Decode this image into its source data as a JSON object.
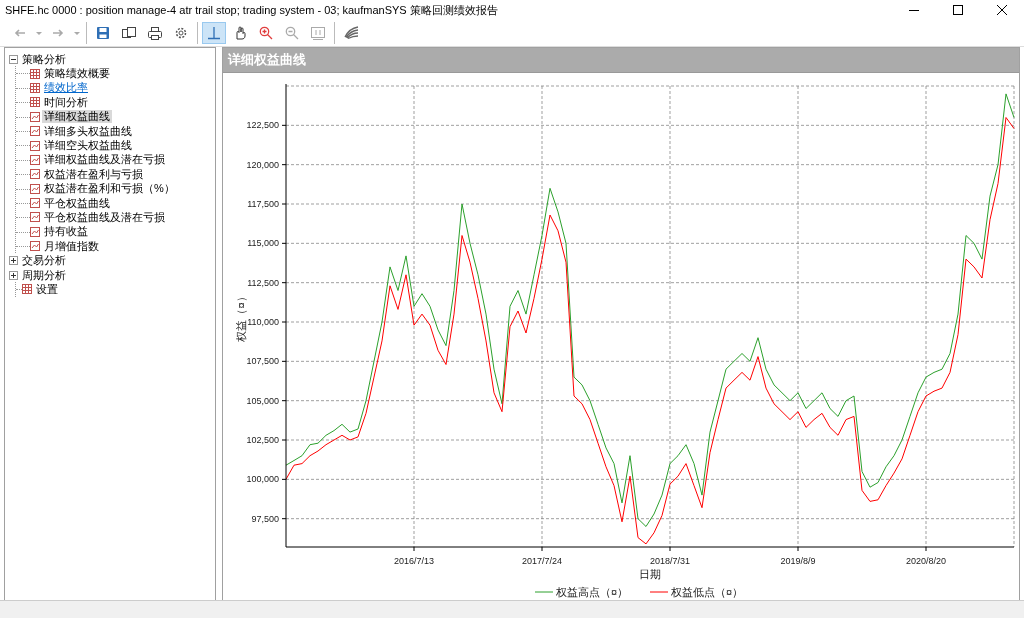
{
  "window": {
    "title": "SHFE.hc 0000 : position manage-4 atr trail stop; trading system - 03; kaufmanSYS 策略回测绩效报告"
  },
  "toolbar": {
    "groups": [
      {
        "tools": [
          {
            "kind": "back",
            "disabled": true,
            "pressed": false
          },
          {
            "kind": "dropdown",
            "disabled": true,
            "pressed": false
          },
          {
            "kind": "forward",
            "disabled": true,
            "pressed": false
          },
          {
            "kind": "dropdown",
            "disabled": true,
            "pressed": false
          }
        ]
      },
      {
        "tools": [
          {
            "kind": "save",
            "disabled": false,
            "pressed": false
          },
          {
            "kind": "copy",
            "disabled": false,
            "pressed": false
          },
          {
            "kind": "print",
            "disabled": false,
            "pressed": false
          },
          {
            "kind": "settings",
            "disabled": false,
            "pressed": false
          }
        ]
      },
      {
        "tools": [
          {
            "kind": "crosshair",
            "disabled": false,
            "pressed": true
          },
          {
            "kind": "pan",
            "disabled": false,
            "pressed": false
          },
          {
            "kind": "zoom-in",
            "disabled": false,
            "pressed": false
          },
          {
            "kind": "zoom-out",
            "disabled": true,
            "pressed": false
          },
          {
            "kind": "fit",
            "disabled": true,
            "pressed": false
          }
        ]
      },
      {
        "tools": [
          {
            "kind": "wing",
            "disabled": false,
            "pressed": false
          }
        ]
      }
    ]
  },
  "tree": [
    {
      "label": "策略分析",
      "kind": "group",
      "expanded": true,
      "selected": false,
      "hovered": false,
      "children": [
        {
          "label": "策略绩效概要",
          "kind": "table",
          "selected": false,
          "hovered": false
        },
        {
          "label": "绩效比率",
          "kind": "table",
          "selected": false,
          "hovered": true
        },
        {
          "label": "时间分析",
          "kind": "table",
          "selected": false,
          "hovered": false
        },
        {
          "label": "详细权益曲线",
          "kind": "chart",
          "selected": true,
          "hovered": false
        },
        {
          "label": "详细多头权益曲线",
          "kind": "chart",
          "selected": false,
          "hovered": false
        },
        {
          "label": "详细空头权益曲线",
          "kind": "chart",
          "selected": false,
          "hovered": false
        },
        {
          "label": "详细权益曲线及潜在亏损",
          "kind": "chart",
          "selected": false,
          "hovered": false
        },
        {
          "label": "权益潜在盈利与亏损",
          "kind": "chart",
          "selected": false,
          "hovered": false
        },
        {
          "label": "权益潜在盈利和亏损（%）",
          "kind": "chart",
          "selected": false,
          "hovered": false
        },
        {
          "label": "平仓权益曲线",
          "kind": "chart",
          "selected": false,
          "hovered": false
        },
        {
          "label": "平仓权益曲线及潜在亏损",
          "kind": "chart",
          "selected": false,
          "hovered": false
        },
        {
          "label": "持有收益",
          "kind": "chart",
          "selected": false,
          "hovered": false
        },
        {
          "label": "月增值指数",
          "kind": "chart",
          "selected": false,
          "hovered": false
        }
      ]
    },
    {
      "label": "交易分析",
      "kind": "group",
      "expanded": false,
      "selected": false,
      "hovered": false
    },
    {
      "label": "周期分析",
      "kind": "group",
      "expanded": false,
      "selected": false,
      "hovered": false
    },
    {
      "label": "设置",
      "kind": "table",
      "selected": false,
      "hovered": false
    }
  ],
  "chart": {
    "title": "详细权益曲线",
    "chart_data": {
      "type": "line",
      "xlabel": "日期",
      "ylabel": "权益（¤）",
      "grid": true,
      "legend": "bottom",
      "categories": [
        null,
        null,
        null,
        null,
        null,
        null,
        null,
        null,
        null,
        null,
        null,
        null,
        null,
        null,
        null,
        null,
        "2016/7/13",
        null,
        null,
        null,
        null,
        null,
        null,
        null,
        null,
        null,
        null,
        null,
        null,
        null,
        null,
        null,
        "2017/7/24",
        null,
        null,
        null,
        null,
        null,
        null,
        null,
        null,
        null,
        null,
        null,
        null,
        null,
        null,
        null,
        "2018/7/31",
        null,
        null,
        null,
        null,
        null,
        null,
        null,
        null,
        null,
        null,
        null,
        null,
        null,
        null,
        null,
        "2019/8/9",
        null,
        null,
        null,
        null,
        null,
        null,
        null,
        null,
        null,
        null,
        null,
        null,
        null,
        null,
        null,
        "2020/8/20",
        null,
        null,
        null,
        null,
        null,
        null,
        null,
        null,
        null,
        null,
        null
      ],
      "ylim": [
        95700,
        125000
      ],
      "yticks": [
        {
          "value": 97500,
          "label": "97,500"
        },
        {
          "value": 100000,
          "label": "100,000"
        },
        {
          "value": 102500,
          "label": "102,500"
        },
        {
          "value": 105000,
          "label": "105,000"
        },
        {
          "value": 107500,
          "label": "107,500"
        },
        {
          "value": 110000,
          "label": "110,000"
        },
        {
          "value": 112500,
          "label": "112,500"
        },
        {
          "value": 115000,
          "label": "115,000"
        },
        {
          "value": 117500,
          "label": "117,500"
        },
        {
          "value": 120000,
          "label": "120,000"
        },
        {
          "value": 122500,
          "label": "122,500"
        }
      ],
      "series": [
        {
          "name": "权益高点（¤）",
          "color": "#2ca02c",
          "values": [
            100900,
            101200,
            101500,
            102200,
            102300,
            102800,
            103100,
            103500,
            103000,
            103200,
            105000,
            107500,
            110000,
            113500,
            112000,
            114200,
            111000,
            111800,
            111000,
            109500,
            108500,
            112000,
            117500,
            115000,
            113000,
            110500,
            107000,
            104800,
            111000,
            112000,
            110500,
            113000,
            115500,
            118500,
            117000,
            115000,
            106500,
            106000,
            105000,
            103500,
            102000,
            101000,
            98500,
            101500,
            97500,
            97000,
            97800,
            99000,
            101000,
            101500,
            102200,
            101000,
            99000,
            103000,
            105000,
            107000,
            107500,
            108000,
            107500,
            109000,
            107000,
            106000,
            105500,
            105000,
            105500,
            104500,
            105000,
            105500,
            104500,
            104000,
            105000,
            105300,
            100500,
            99500,
            99800,
            100800,
            101500,
            102500,
            104000,
            105500,
            106500,
            106800,
            107000,
            108000,
            110500,
            115500,
            115000,
            114000,
            118000,
            120000,
            124500,
            123000
          ]
        },
        {
          "name": "权益低点（¤）",
          "color": "#ff0000",
          "values": [
            100000,
            100900,
            101000,
            101500,
            101800,
            102200,
            102500,
            102800,
            102500,
            102700,
            104200,
            106500,
            108800,
            112300,
            110800,
            113000,
            109800,
            110500,
            109800,
            108200,
            107300,
            110500,
            115500,
            113800,
            111500,
            108800,
            105500,
            104300,
            109700,
            110700,
            109300,
            111500,
            114000,
            116800,
            115800,
            113800,
            105300,
            104800,
            103800,
            102300,
            100800,
            99600,
            97300,
            100200,
            96300,
            95900,
            96600,
            97700,
            99700,
            100200,
            101000,
            99600,
            98200,
            101700,
            103800,
            105800,
            106300,
            106800,
            106300,
            107800,
            105800,
            104800,
            104300,
            103800,
            104300,
            103300,
            103800,
            104200,
            103300,
            102800,
            103800,
            104000,
            99300,
            98600,
            98700,
            99600,
            100400,
            101300,
            102800,
            104300,
            105300,
            105600,
            105800,
            106800,
            109200,
            114000,
            113500,
            112800,
            116500,
            118800,
            123000,
            122300
          ]
        }
      ]
    }
  }
}
